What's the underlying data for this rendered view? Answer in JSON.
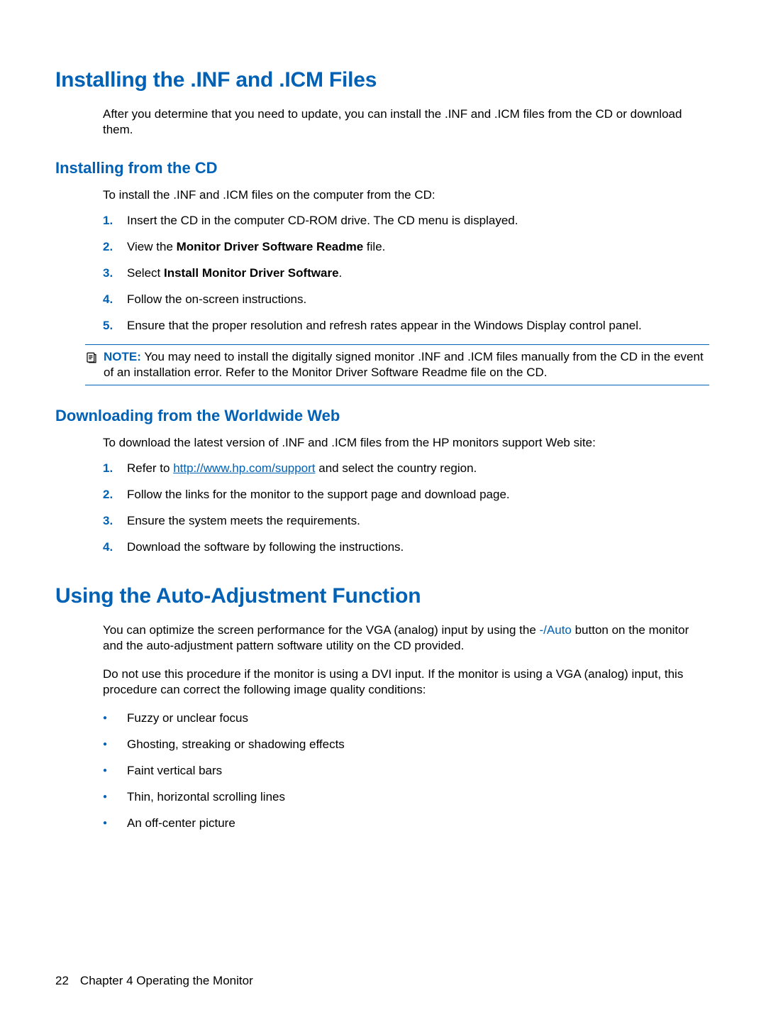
{
  "s1": {
    "heading": "Installing the .INF and .ICM Files",
    "intro": "After you determine that you need to update, you can install the .INF and .ICM files from the CD or download them.",
    "cd": {
      "heading": "Installing from the CD",
      "intro": "To install the .INF and .ICM files on the computer from the CD:",
      "steps": {
        "n1": "1.",
        "t1": "Insert the CD in the computer CD-ROM drive. The CD menu is displayed.",
        "n2": "2.",
        "t2_pre": "View the ",
        "t2_bold": "Monitor Driver Software Readme",
        "t2_post": " file.",
        "n3": "3.",
        "t3_pre": "Select ",
        "t3_bold": "Install Monitor Driver Software",
        "t3_post": ".",
        "n4": "4.",
        "t4": "Follow the on-screen instructions.",
        "n5": "5.",
        "t5": "Ensure that the proper resolution and refresh rates appear in the Windows Display control panel."
      },
      "note_label": "NOTE:",
      "note_text": "You may need to install the digitally signed monitor .INF and .ICM files manually from the CD in the event of an installation error. Refer to the Monitor Driver Software Readme file on the CD."
    },
    "web": {
      "heading": "Downloading from the Worldwide Web",
      "intro": "To download the latest version of .INF and .ICM files from the HP monitors support Web site:",
      "steps": {
        "n1": "1.",
        "t1_pre": "Refer to ",
        "t1_link": "http://www.hp.com/support",
        "t1_post": " and select the country region.",
        "n2": "2.",
        "t2": "Follow the links for the monitor to the support page and download page.",
        "n3": "3.",
        "t3": "Ensure the system meets the requirements.",
        "n4": "4.",
        "t4": "Download the software by following the instructions."
      }
    }
  },
  "s2": {
    "heading": "Using the Auto-Adjustment Function",
    "p1_pre": "You can optimize the screen performance for the VGA (analog) input by using the ",
    "p1_auto": "-/Auto",
    "p1_post": " button on the monitor and the auto-adjustment pattern software utility on the CD provided.",
    "p2": "Do not use this procedure if the monitor is using a DVI input. If the monitor is using a VGA (analog) input, this procedure can correct the following image quality conditions:",
    "bullets": {
      "b1": "Fuzzy or unclear focus",
      "b2": "Ghosting, streaking or shadowing effects",
      "b3": "Faint vertical bars",
      "b4": "Thin, horizontal scrolling lines",
      "b5": "An off-center picture"
    }
  },
  "footer": {
    "page": "22",
    "chapter": "Chapter 4   Operating the Monitor"
  }
}
